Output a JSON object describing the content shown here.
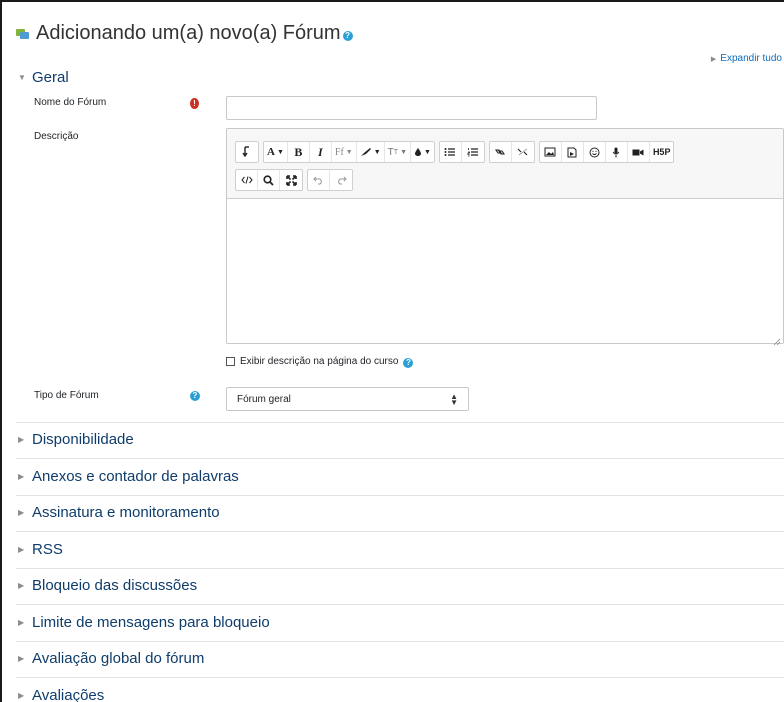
{
  "page": {
    "title": "Adicionando um(a) novo(a) Fórum",
    "expand_all": "Expandir tudo"
  },
  "sections": {
    "general": "Geral",
    "collapsed": [
      "Disponibilidade",
      "Anexos e contador de palavras",
      "Assinatura e monitoramento",
      "RSS",
      "Bloqueio das discussões",
      "Limite de mensagens para bloqueio",
      "Avaliação global do fórum",
      "Avaliações"
    ]
  },
  "form": {
    "name_label": "Nome do Fórum",
    "name_value": "",
    "description_label": "Descrição",
    "show_description": "Exibir descrição na página do curso",
    "forum_type_label": "Tipo de Fórum",
    "forum_type_value": "Fórum geral"
  },
  "toolbar": {
    "font_color": "A",
    "bold": "B",
    "italic": "I",
    "font_family": "Ff",
    "h5p": "H5P"
  },
  "colors": {
    "link": "#0f6cbf",
    "section": "#0f3d6b",
    "required": "#ca3120",
    "help": "#2a9fd6"
  }
}
